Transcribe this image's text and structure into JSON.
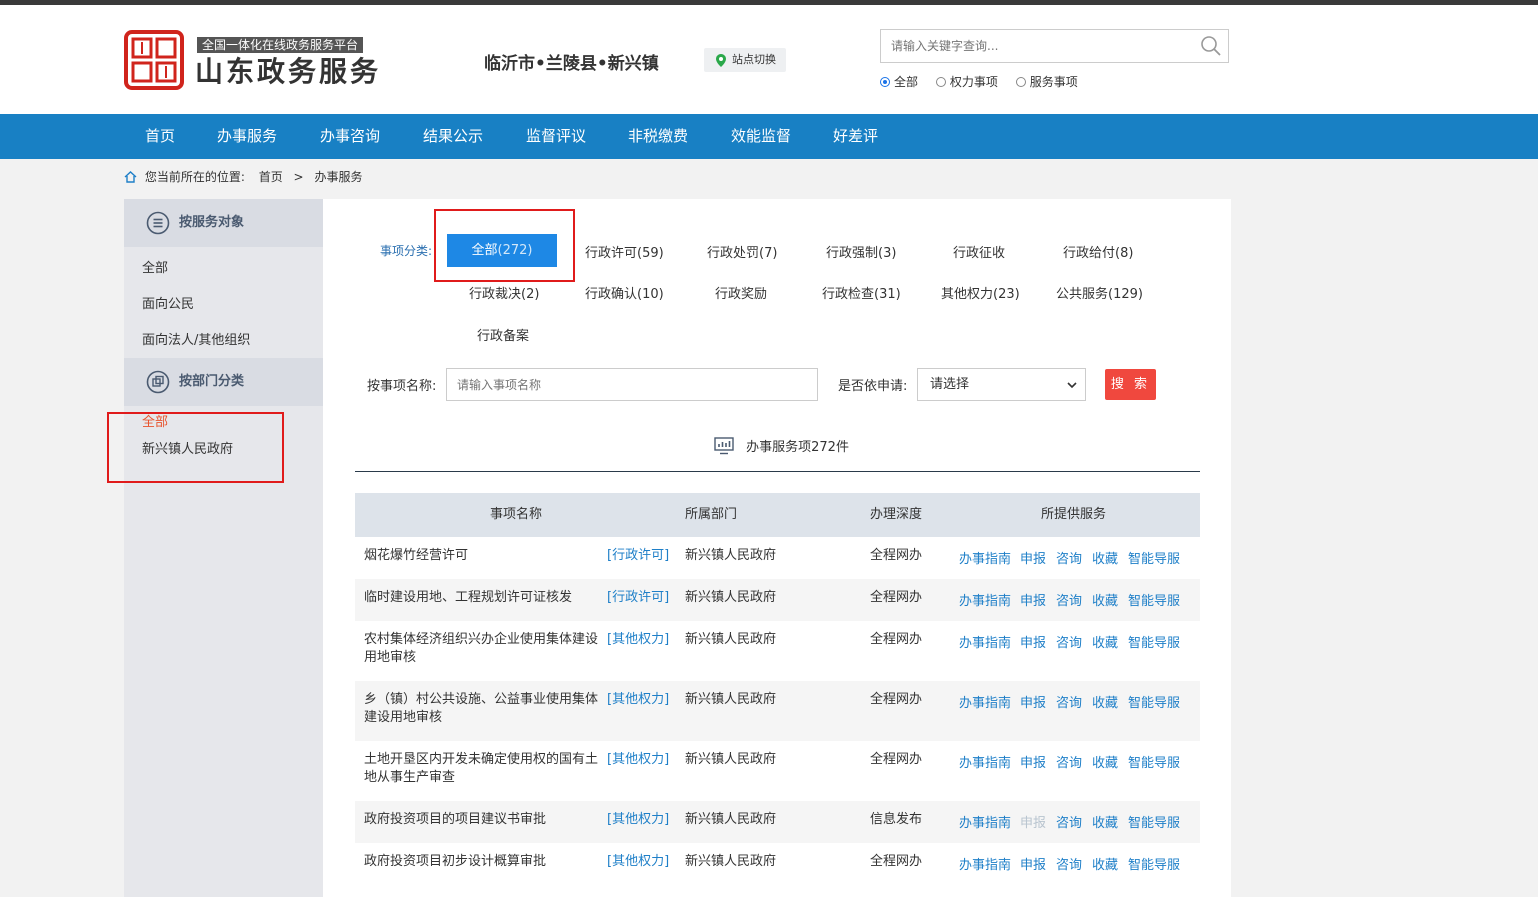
{
  "header": {
    "logo_sub": "全国一体化在线政务服务平台",
    "logo_main": "山东政务服务",
    "location": "临沂市•兰陵县•新兴镇",
    "switch_site": "站点切换",
    "search_placeholder": "请输入关键字查询...",
    "search_scopes": [
      "全部",
      "权力事项",
      "服务事项"
    ],
    "selected_scope": "全部"
  },
  "nav": [
    "首页",
    "办事服务",
    "办事咨询",
    "结果公示",
    "监督评议",
    "非税缴费",
    "效能监督",
    "好差评"
  ],
  "breadcrumb": {
    "prefix": "您当前所在的位置:",
    "items": [
      "首页",
      "办事服务"
    ],
    "sep": ">"
  },
  "sidebar": {
    "by_target": {
      "title": "按服务对象",
      "items": [
        "全部",
        "面向公民",
        "面向法人/其他组织"
      ]
    },
    "by_dept": {
      "title": "按部门分类",
      "items": [
        "全部",
        "新兴镇人民政府"
      ]
    }
  },
  "categories": {
    "label": "事项分类:",
    "items": [
      {
        "label": "全部",
        "count": "(272)"
      },
      {
        "label": "行政许可(59)"
      },
      {
        "label": "行政处罚(7)"
      },
      {
        "label": "行政强制(3)"
      },
      {
        "label": "行政征收"
      },
      {
        "label": "行政给付(8)"
      },
      {
        "label": "行政裁决(2)"
      },
      {
        "label": "行政确认(10)"
      },
      {
        "label": "行政奖励"
      },
      {
        "label": "行政检查(31)"
      },
      {
        "label": "其他权力(23)"
      },
      {
        "label": "公共服务(129)"
      },
      {
        "label": "行政备案"
      }
    ]
  },
  "filter": {
    "name_label": "按事项名称:",
    "name_placeholder": "请输入事项名称",
    "apply_label": "是否依申请:",
    "apply_value": "请选择",
    "search_button": "搜 索"
  },
  "count_text": "办事服务项272件",
  "table": {
    "headers": [
      "事项名称",
      "所属部门",
      "办理深度",
      "所提供服务"
    ],
    "services": [
      "办事指南",
      "申报",
      "咨询",
      "收藏",
      "智能导服"
    ],
    "rows": [
      {
        "name": "烟花爆竹经营许可",
        "type": "[行政许可]",
        "dept": "新兴镇人民政府",
        "depth": "全程网办"
      },
      {
        "name": "临时建设用地、工程规划许可证核发",
        "type": "[行政许可]",
        "dept": "新兴镇人民政府",
        "depth": "全程网办"
      },
      {
        "name": "农村集体经济组织兴办企业使用集体建设用地审核",
        "type": "[其他权力]",
        "dept": "新兴镇人民政府",
        "depth": "全程网办"
      },
      {
        "name": "乡（镇）村公共设施、公益事业使用集体建设用地审核",
        "type": "[其他权力]",
        "dept": "新兴镇人民政府",
        "depth": "全程网办"
      },
      {
        "name": "土地开垦区内开发未确定使用权的国有土地从事生产审查",
        "type": "[其他权力]",
        "dept": "新兴镇人民政府",
        "depth": "全程网办"
      },
      {
        "name": "政府投资项目的项目建议书审批",
        "type": "[其他权力]",
        "dept": "新兴镇人民政府",
        "depth": "信息发布"
      },
      {
        "name": "政府投资项目初步设计概算审批",
        "type": "[其他权力]",
        "dept": "新兴镇人民政府",
        "depth": "全程网办"
      }
    ]
  },
  "colors": {
    "nav_bg": "#1880c4",
    "accent_blue": "#1e88e5",
    "link_blue": "#1e7fc8",
    "search_red": "#f0483e",
    "highlight_red": "#e01b1b"
  }
}
